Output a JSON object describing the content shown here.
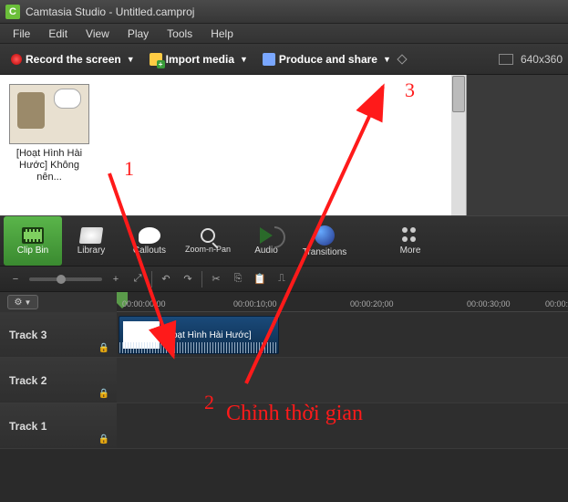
{
  "title": "Camtasia Studio - Untitled.camproj",
  "logo_letter": "C",
  "menu": [
    "File",
    "Edit",
    "View",
    "Play",
    "Tools",
    "Help"
  ],
  "actions": {
    "record": "Record the screen",
    "import": "Import media",
    "produce": "Produce and share"
  },
  "dimensions": "640x360",
  "clipbin_item": {
    "label": "[Hoạt Hình Hài Hước] Không nên..."
  },
  "tabs": {
    "clipbin": "Clip Bin",
    "library": "Library",
    "callouts": "Callouts",
    "zoom": "Zoom-n-Pan",
    "audio": "Audio",
    "transitions": "Transitions",
    "more": "More"
  },
  "ruler": {
    "t0": "00:00:00;00",
    "t1": "00:00:10;00",
    "t2": "00:00:20;00",
    "t3": "00:00:30;00",
    "t4": "00:00:"
  },
  "tracks": {
    "t3": "Track 3",
    "t2": "Track 2",
    "t1": "Track 1"
  },
  "clip_label": "[Hoạt Hình Hài Hước]",
  "annotations": {
    "n1": "1",
    "n2": "2",
    "n3": "3",
    "main": "Chỉnh thời gian"
  }
}
